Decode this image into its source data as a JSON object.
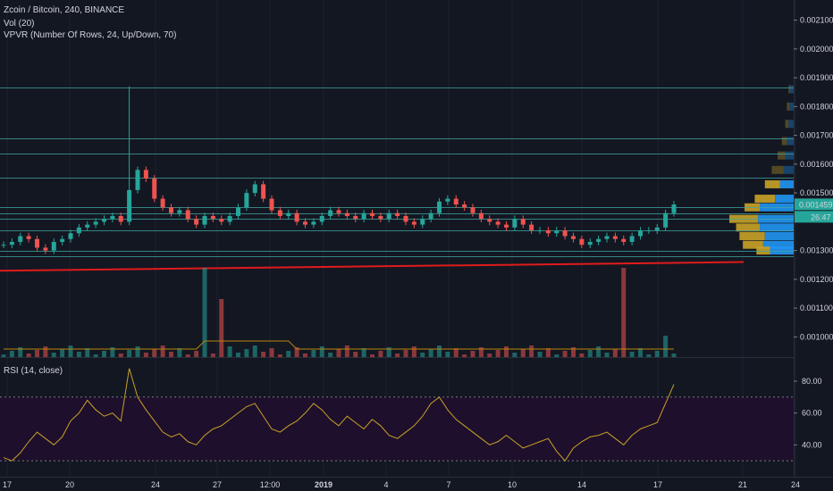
{
  "legend": {
    "symbol": "Zcoin / Bitcoin, 240, BINANCE",
    "volume": "Vol (20)",
    "vpvr": "VPVR (Number Of Rows, 24, Up/Down, 70)",
    "rsi": "RSI (14, close)"
  },
  "colors": {
    "background": "#131722",
    "up": "#26a69a",
    "down": "#ef5350",
    "vp_up": "#2196f3",
    "vp_down": "#c9a227",
    "hline": "#3fa9a3",
    "trendline": "#e01b1b",
    "rsi_band": "#1e0f2c",
    "rsi_line": "#c9a227"
  },
  "chart_data": [
    {
      "type": "candlestick",
      "title": "Zcoin / Bitcoin, 240, BINANCE",
      "x_ticks": [
        "17",
        "20",
        "24",
        "27",
        "12:00",
        "2019",
        "4",
        "7",
        "10",
        "14",
        "17",
        "21",
        "24"
      ],
      "y_ticks": [
        "0.002100",
        "0.002000",
        "0.001900",
        "0.001800",
        "0.001700",
        "0.001600",
        "0.001500",
        "0.001300",
        "0.001200",
        "0.001100",
        "0.001000"
      ],
      "ylim": [
        0.00093,
        0.00217
      ],
      "last_price": "0.001459",
      "countdown": "26:47",
      "horizontal_levels": [
        0.001867,
        0.00169,
        0.001638,
        0.001552,
        0.00145,
        0.00143,
        0.00141,
        0.00137,
        0.0013,
        0.00128
      ],
      "trend_line": {
        "from": 0.00123,
        "to": 0.00126
      },
      "price_series": [
        0.00132,
        0.00133,
        0.00135,
        0.00134,
        0.00131,
        0.0013,
        0.00133,
        0.00134,
        0.00136,
        0.00138,
        0.00139,
        0.0014,
        0.00141,
        0.00142,
        0.0014,
        0.00151,
        0.00158,
        0.00155,
        0.00148,
        0.00145,
        0.00143,
        0.00144,
        0.00141,
        0.00139,
        0.00142,
        0.00141,
        0.0014,
        0.00142,
        0.00145,
        0.0015,
        0.00153,
        0.00148,
        0.00144,
        0.00142,
        0.00143,
        0.0014,
        0.00139,
        0.0014,
        0.00142,
        0.00144,
        0.00143,
        0.00142,
        0.00141,
        0.00143,
        0.00142,
        0.00141,
        0.00143,
        0.00142,
        0.0014,
        0.00139,
        0.00141,
        0.00143,
        0.00147,
        0.00148,
        0.00146,
        0.00145,
        0.00143,
        0.00141,
        0.0014,
        0.00139,
        0.00138,
        0.00141,
        0.00139,
        0.00137,
        0.00137,
        0.00136,
        0.00137,
        0.00135,
        0.00134,
        0.00132,
        0.00133,
        0.00134,
        0.00135,
        0.00134,
        0.00133,
        0.00135,
        0.00137,
        0.00137,
        0.00138,
        0.00143,
        0.00146
      ],
      "volume_profile": [
        {
          "price": 0.00186,
          "up": 4,
          "down": 2
        },
        {
          "price": 0.0018,
          "up": 5,
          "down": 3
        },
        {
          "price": 0.00174,
          "up": 6,
          "down": 4
        },
        {
          "price": 0.00168,
          "up": 8,
          "down": 6
        },
        {
          "price": 0.00163,
          "up": 10,
          "down": 9
        },
        {
          "price": 0.00158,
          "up": 12,
          "down": 14
        },
        {
          "price": 0.00153,
          "up": 16,
          "down": 18
        },
        {
          "price": 0.00148,
          "up": 22,
          "down": 24
        },
        {
          "price": 0.00145,
          "up": 40,
          "down": 18
        },
        {
          "price": 0.00141,
          "up": 42,
          "down": 34
        },
        {
          "price": 0.00138,
          "up": 40,
          "down": 28
        },
        {
          "price": 0.00135,
          "up": 34,
          "down": 30
        },
        {
          "price": 0.00132,
          "up": 36,
          "down": 24
        },
        {
          "price": 0.0013,
          "up": 28,
          "down": 16
        }
      ]
    },
    {
      "type": "bar",
      "title": "Vol (20)",
      "spikes": [
        {
          "x_index": 24,
          "value": 100
        },
        {
          "x_index": 26,
          "value": 65
        },
        {
          "x_index": 74,
          "value": 100
        },
        {
          "x_index": 79,
          "value": 24
        }
      ]
    },
    {
      "type": "line",
      "title": "RSI (14, close)",
      "y_ticks": [
        "80.00",
        "60.00",
        "40.00"
      ],
      "ylim": [
        20,
        94
      ],
      "bands": [
        70,
        30
      ],
      "values": [
        32,
        30,
        35,
        42,
        48,
        44,
        40,
        45,
        55,
        60,
        68,
        62,
        58,
        60,
        55,
        88,
        70,
        62,
        55,
        48,
        45,
        47,
        42,
        40,
        46,
        50,
        52,
        56,
        60,
        64,
        66,
        58,
        50,
        48,
        52,
        55,
        60,
        66,
        62,
        56,
        52,
        58,
        54,
        50,
        56,
        52,
        46,
        44,
        48,
        52,
        58,
        66,
        70,
        62,
        56,
        52,
        48,
        44,
        40,
        42,
        46,
        42,
        38,
        40,
        42,
        44,
        36,
        30,
        38,
        42,
        45,
        46,
        48,
        44,
        40,
        46,
        50,
        52,
        54,
        66,
        78
      ]
    }
  ]
}
